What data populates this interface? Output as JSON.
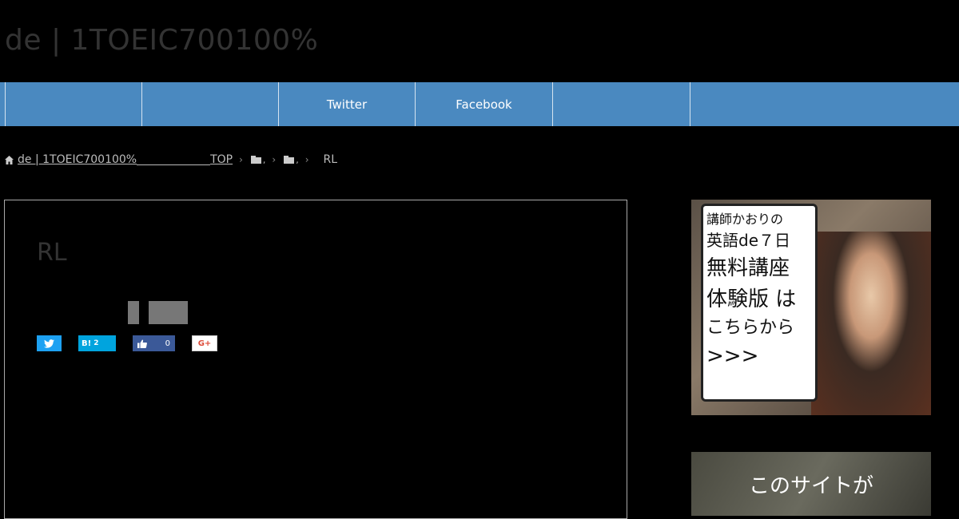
{
  "site": {
    "title": "de | 1TOEIC700100%"
  },
  "nav": {
    "items": [
      "",
      "",
      "",
      "Twitter",
      "Facebook",
      "",
      ""
    ]
  },
  "breadcrumb": {
    "home_label": "de | 1TOEIC700100%",
    "top_label": "TOP",
    "cat1_label": ",",
    "cat2_label": ",",
    "current": "RL"
  },
  "article": {
    "title": "RL"
  },
  "share": {
    "hatena_label": "B!",
    "hatena_count": "2",
    "facebook_count": "0",
    "google_label": "G+"
  },
  "ads": {
    "ad1": {
      "lines": [
        "講師かおりの",
        "英語de７日",
        "無料講座",
        "体験版 は",
        "こちらから",
        ">>>"
      ]
    },
    "ad2": {
      "text": "このサイトが"
    }
  },
  "colors": {
    "nav_bg": "#4a89c0",
    "twitter": "#1da1f2",
    "hatena": "#00a4de",
    "facebook": "#3b5998"
  },
  "icons": [
    "home-icon",
    "folder-icon",
    "chevron-right-icon",
    "twitter-icon",
    "thumbs-up-icon"
  ]
}
